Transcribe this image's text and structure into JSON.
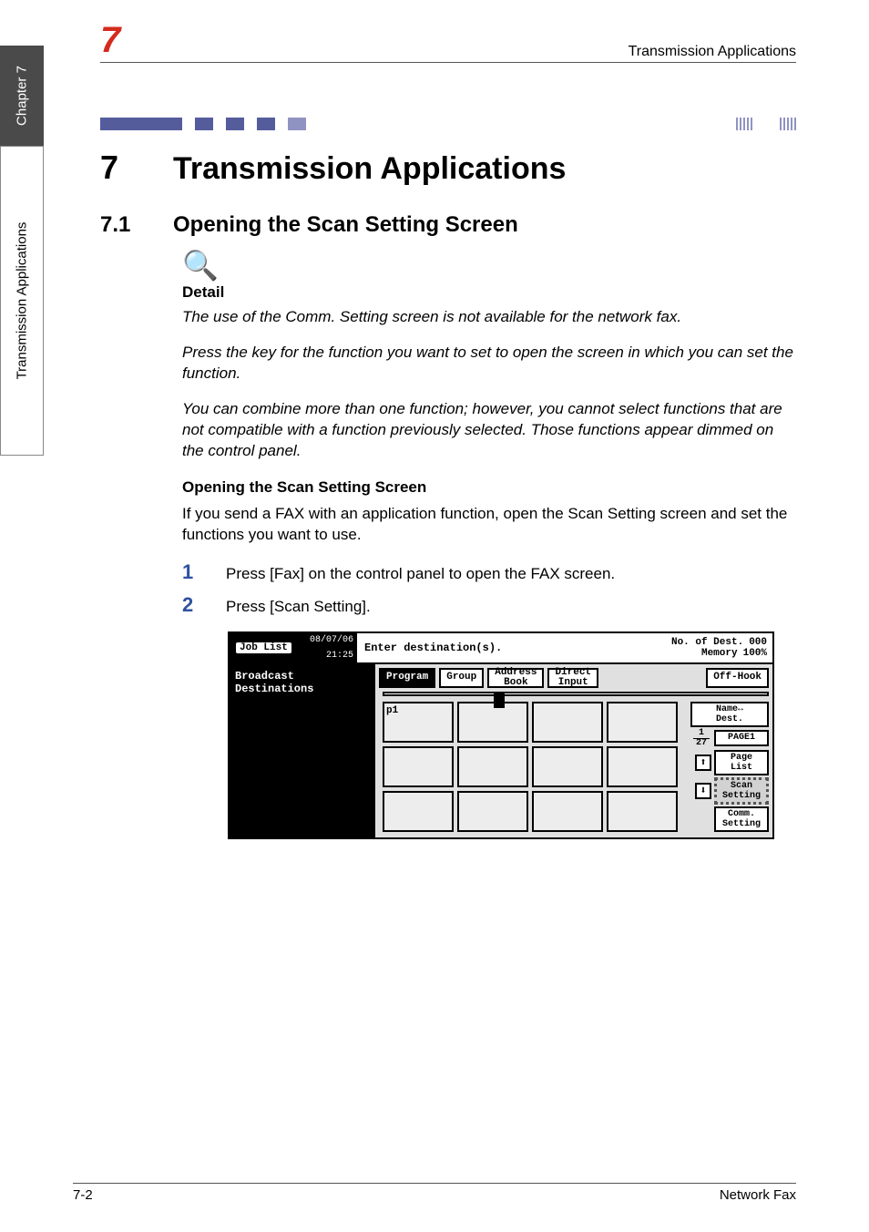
{
  "side_tabs": {
    "chapter_tab": "Chapter 7",
    "section_tab": "Transmission Applications"
  },
  "running_header": {
    "number": "7",
    "title": "Transmission Applications"
  },
  "chapter": {
    "number": "7",
    "title": "Transmission Applications"
  },
  "section": {
    "number": "7.1",
    "title": "Opening the Scan Setting Screen"
  },
  "detail": {
    "label": "Detail",
    "para1": "The use of the Comm. Setting screen is not available for the network fax.",
    "para2": "Press the key for the function you want to set to open the screen in which you can set the function.",
    "para3": "You can combine more than one function; however, you cannot select functions that are not compatible with a function previously selected. Those functions appear dimmed on the control panel."
  },
  "subheading": "Opening the Scan Setting Screen",
  "intro_para": "If you send a FAX with an application function, open the Scan Setting screen and set the functions you want to use.",
  "steps": {
    "s1_num": "1",
    "s1_text": "Press [Fax] on the control panel to open the FAX screen.",
    "s2_num": "2",
    "s2_text": "Press [Scan Setting]."
  },
  "screenshot": {
    "job_list_btn": "Job\nList",
    "date": "08/07/06",
    "time": "21:25",
    "prompt": "Enter destination(s).",
    "no_of_dest_label": "No. of\nDest.",
    "no_of_dest_value": "000",
    "memory_label": "Memory",
    "memory_value": "100%",
    "left_panel": "Broadcast\nDestinations",
    "tabs": {
      "program": "Program",
      "group": "Group",
      "address_book": "Address\nBook",
      "direct_input": "Direct\nInput",
      "off_hook": "Off-Hook"
    },
    "first_cell": "p1",
    "page_frac_top": "1",
    "page_frac_bottom": "27",
    "side_buttons": {
      "name_dest": "Name↔\nDest.",
      "page1": "PAGE1",
      "page_list": "Page\nList",
      "scan_setting": "Scan\nSetting",
      "comm_setting": "Comm.\nSetting"
    },
    "arrow_up": "⬆",
    "arrow_down": "⬇"
  },
  "footer": {
    "left": "7-2",
    "right": "Network Fax"
  }
}
